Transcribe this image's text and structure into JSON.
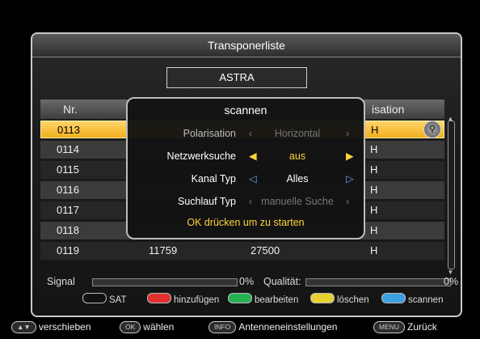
{
  "window": {
    "title": "Transponerliste",
    "satellite": "ASTRA"
  },
  "table": {
    "headers": {
      "nr": "Nr.",
      "pol": "isation"
    },
    "rows": [
      {
        "nr": "0113",
        "freq": "",
        "sr": "",
        "pol": "H",
        "selected": true
      },
      {
        "nr": "0114",
        "freq": "",
        "sr": "",
        "pol": "H"
      },
      {
        "nr": "0115",
        "freq": "",
        "sr": "",
        "pol": "H"
      },
      {
        "nr": "0116",
        "freq": "",
        "sr": "",
        "pol": "H"
      },
      {
        "nr": "0117",
        "freq": "",
        "sr": "",
        "pol": "H"
      },
      {
        "nr": "0118",
        "freq": "",
        "sr": "",
        "pol": "H"
      },
      {
        "nr": "0119",
        "freq": "11759",
        "sr": "27500",
        "pol": "H"
      }
    ]
  },
  "dialog": {
    "title": "scannen",
    "options": [
      {
        "label": "Polarisation",
        "value": "Horizontal",
        "left": "‹",
        "right": "›"
      },
      {
        "label": "Netzwerksuche",
        "value": "aus",
        "left": "◀",
        "right": "▶"
      },
      {
        "label": "Kanal Typ",
        "value": "Alles",
        "left": "◁",
        "right": "▷"
      },
      {
        "label": "Suchlauf Typ",
        "value": "manuelle Suche",
        "left": "‹",
        "right": "›"
      }
    ],
    "hint": "OK drücken um zu starten"
  },
  "status": {
    "signal_label": "Signal",
    "signal_value": "0%",
    "quality_label": "Qualität:",
    "quality_value": "0%",
    "signal_level": 0,
    "quality_level": 0
  },
  "legend": {
    "sat": "SAT",
    "red": "hinzufügen",
    "green": "bearbeiten",
    "yellow": "löschen",
    "blue": "scannen",
    "colors": {
      "red": "#e03030",
      "green": "#28b050",
      "yellow": "#e8d030",
      "blue": "#3aa0e0"
    }
  },
  "bottom": {
    "move_key": "▲▼",
    "move_label": "verschieben",
    "ok_key": "OK",
    "ok_label": "wählen",
    "info_key": "INFO",
    "info_label": "Antenneneinstellungen",
    "menu_key": "MENU",
    "menu_label": "Zurück"
  }
}
